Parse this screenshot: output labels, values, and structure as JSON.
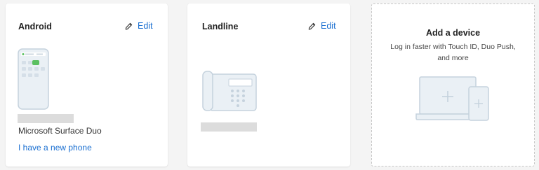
{
  "cards": [
    {
      "title": "Android",
      "edit_label": "Edit",
      "device_name": "Microsoft Surface Duo",
      "link_label": "I have a new phone"
    },
    {
      "title": "Landline",
      "edit_label": "Edit"
    }
  ],
  "add_device": {
    "title": "Add a device",
    "description": "Log in faster with Touch ID, Duo Push, and more"
  },
  "colors": {
    "link": "#1a6fd1",
    "illustration_fill": "#eaf0f5",
    "illustration_stroke": "#c5d2dd",
    "redacted": "#dcdcdc"
  },
  "icons": [
    "pencil-icon",
    "phone-illustration",
    "desk-phone-illustration",
    "laptop-tablet-illustration"
  ]
}
